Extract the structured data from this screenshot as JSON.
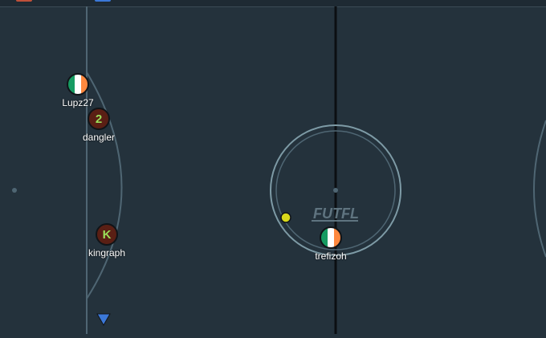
{
  "colors": {
    "field": "#24323c",
    "lines": "#4f6673",
    "center_line": "#0b0f12",
    "center_circle": "#7e9ba6",
    "ball": "#d8d81a",
    "red_team": "#5a1f14",
    "red_team_text": "#9be05a",
    "blue_arrow": "#3b78d8"
  },
  "players": [
    {
      "name": "Lupz27",
      "avatar_kind": "flag-ireland",
      "avatar_text": ""
    },
    {
      "name": "dangler",
      "avatar_kind": "number",
      "avatar_text": "2"
    },
    {
      "name": "kingraph",
      "avatar_kind": "letter",
      "avatar_text": "K"
    },
    {
      "name": "trefizoh",
      "avatar_kind": "flag-ireland",
      "avatar_text": ""
    }
  ],
  "center_logo": "FUTFL",
  "icons": {
    "ball": "ball-icon",
    "offscreen_marker": "down-arrow-icon",
    "logo": "league-logo-icon"
  }
}
